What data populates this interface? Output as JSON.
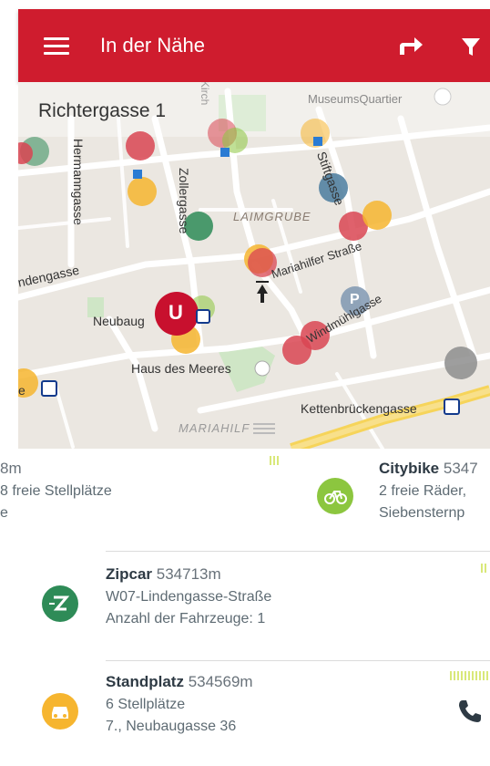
{
  "header": {
    "title": "In der Nähe",
    "menu_icon": "menu-icon",
    "route_icon": "route-arrow-icon",
    "filter_icon": "filter-icon",
    "brand_color": "#cf1c2e"
  },
  "map": {
    "location_title": "Richtergasse 1",
    "labels": {
      "museumsquartier": "MuseumsQuartier",
      "hermanngasse": "Hermanngasse",
      "zollergasse": "Zollergasse",
      "stiftgasse": "Stiftgasse",
      "laimgrube": "LAIMGRUBE",
      "mariahilfer": "Mariahilfer Straße",
      "lindengasse": "ndengasse",
      "neubaugasse": "Neubaug",
      "windmuehlgasse": "Windmühlgasse",
      "haus_des_meeres": "Haus des Meeres",
      "kettenbrueckengasse": "Kettenbrückengasse",
      "mariahilf": "MARIAHILF",
      "kirche": "Kirch",
      "edge_ubahn": "e"
    },
    "ubahn_letter": "U",
    "parking_letter": "P"
  },
  "cards": {
    "partial_left": {
      "title_suffix": "8m",
      "line1": "8 freie Stellplätze",
      "line2": "e"
    },
    "citybike": {
      "name": "Citybike",
      "distance": "5347",
      "line1": "2 freie Räder,",
      "line2": "Siebensternp",
      "icon": "bike-icon",
      "color": "#8cc63f"
    },
    "zipcar": {
      "name": "Zipcar",
      "distance": "534713m",
      "line1": "W07-Lindengasse-Straße",
      "line2": "Anzahl der Fahrzeuge: 1",
      "icon": "zipcar-icon",
      "color": "#2e8b57"
    },
    "standplatz": {
      "name": "Standplatz",
      "distance": "534569m",
      "line1": "6 Stellplätze",
      "line2": "7., Neubaugasse 36",
      "icon": "taxi-icon",
      "color": "#f6b52f",
      "action_icon": "phone-icon"
    }
  }
}
